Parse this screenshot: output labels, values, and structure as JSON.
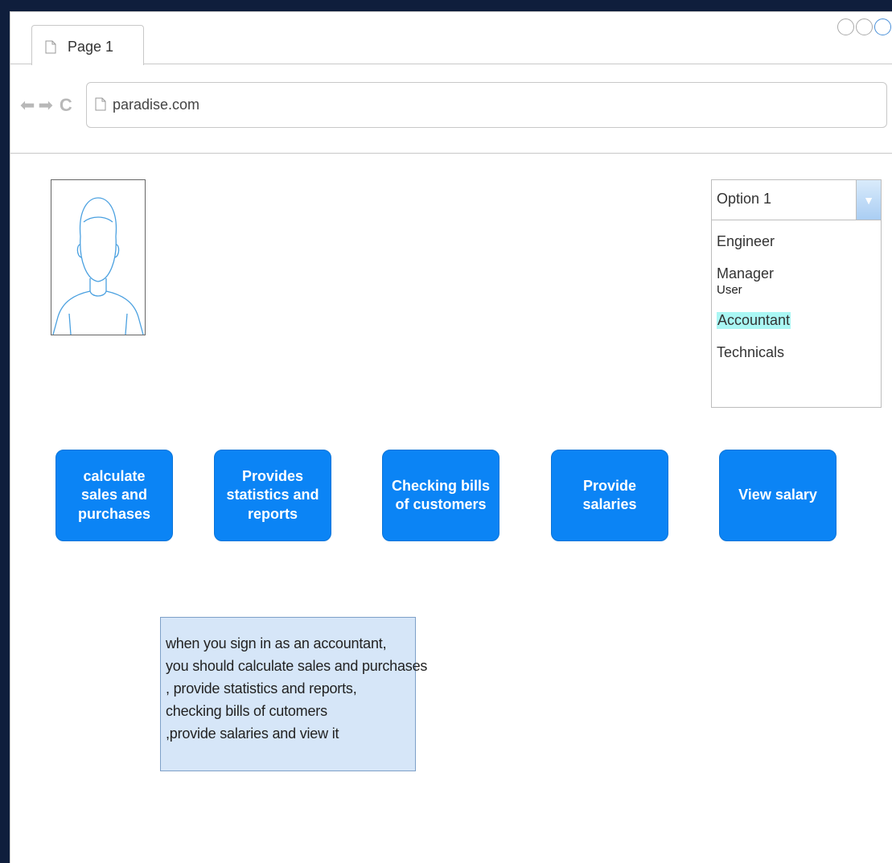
{
  "browser": {
    "tab_label": "Page 1",
    "url": "paradise.com"
  },
  "role_select": {
    "selected": "Option 1",
    "options": [
      "Engineer",
      "Manager",
      "User",
      "Accountant",
      "Technicals"
    ],
    "highlighted": "Accountant"
  },
  "actions": [
    "calculate sales and purchases",
    "Provides statistics and reports",
    "Checking bills of customers",
    "Provide salaries",
    "View salary"
  ],
  "note": {
    "lines": [
      "when you sign in as an accountant,",
      "you should calculate sales and purchases",
      ", provide statistics and reports,",
      "checking bills of cutomers",
      ",provide salaries and view it"
    ]
  },
  "colors": {
    "button": "#0b84f5",
    "note_background": "#d6e6f8",
    "highlight": "#aaf7f4"
  }
}
